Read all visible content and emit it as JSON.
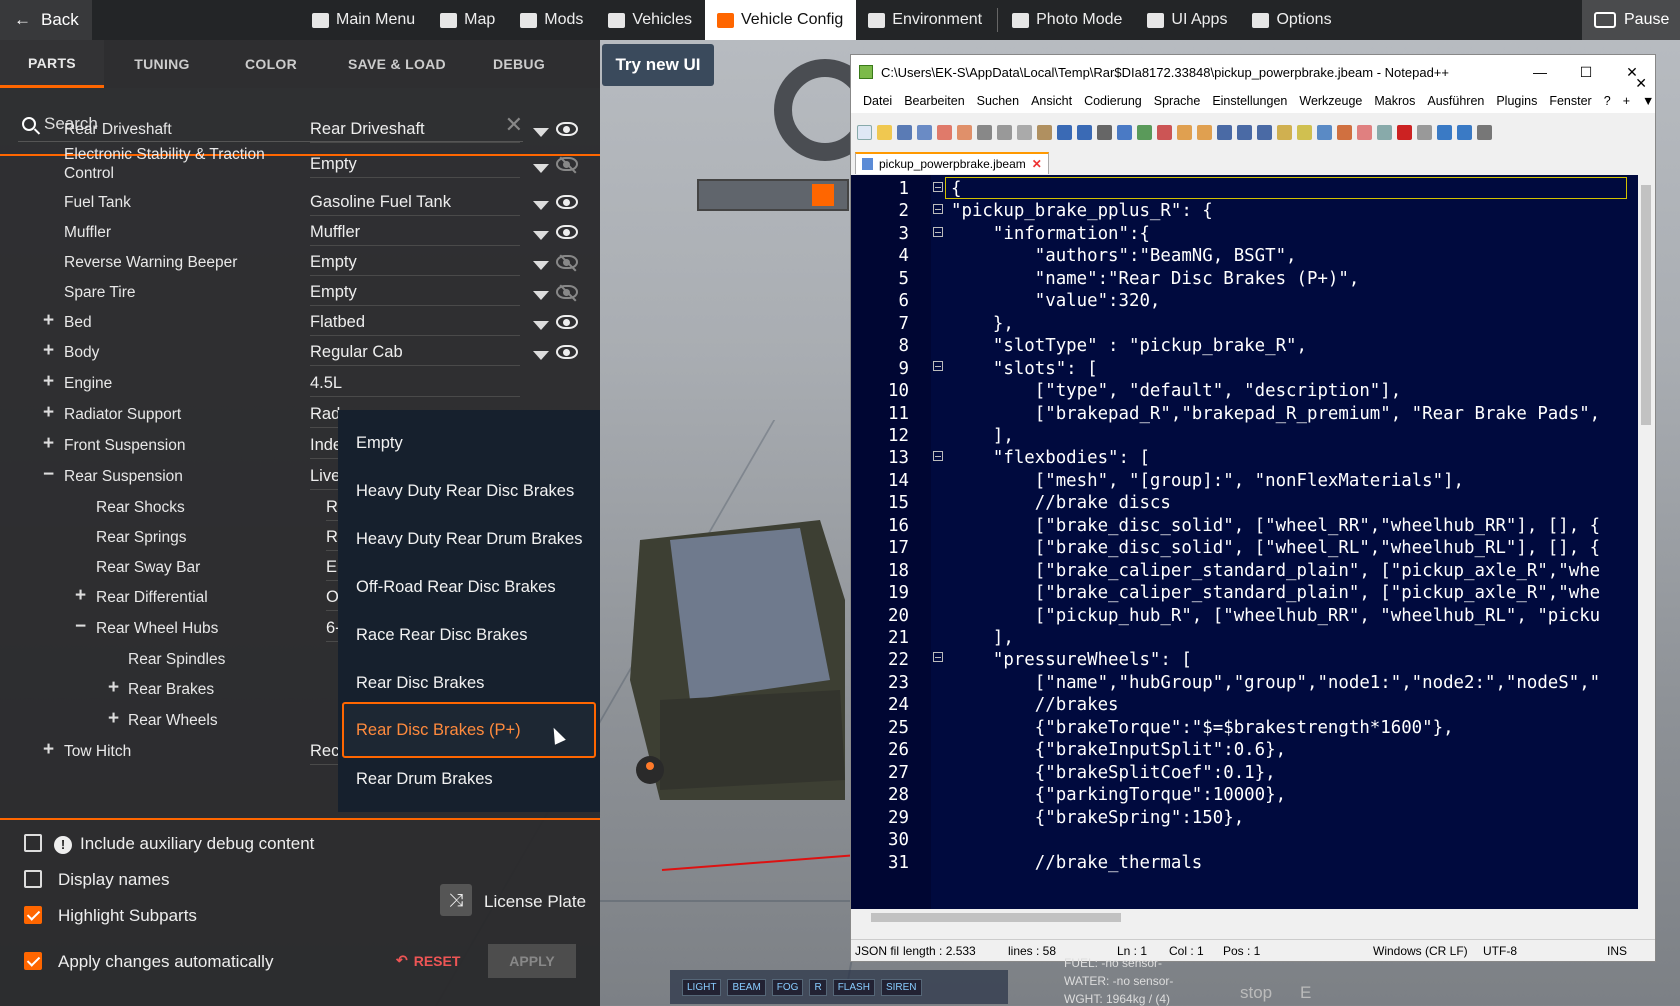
{
  "topbar": {
    "back": "Back",
    "nav": [
      {
        "label": "Main Menu",
        "icon": "main-menu-icon"
      },
      {
        "label": "Map",
        "icon": "map-icon"
      },
      {
        "label": "Mods",
        "icon": "mods-icon"
      },
      {
        "label": "Vehicles",
        "icon": "vehicles-icon"
      },
      {
        "label": "Vehicle Config",
        "icon": "vehicle-config-icon",
        "active": true
      },
      {
        "label": "Environment",
        "icon": "environment-icon"
      },
      {
        "label": "Photo Mode",
        "icon": "camera-icon"
      },
      {
        "label": "UI Apps",
        "icon": "ui-apps-icon"
      },
      {
        "label": "Options",
        "icon": "options-icon"
      }
    ],
    "pause": "Pause"
  },
  "tabs": [
    "PARTS",
    "TUNING",
    "COLOR",
    "SAVE & LOAD",
    "DEBUG"
  ],
  "search": {
    "placeholder": "Search"
  },
  "parts": [
    {
      "name": "Rear Driveshaft",
      "value": "Rear Driveshaft",
      "visible": true
    },
    {
      "name": "Electronic Stability & Traction",
      "name2": "Control",
      "value": "Empty",
      "visible": false
    },
    {
      "name": "Fuel Tank",
      "value": "Gasoline Fuel Tank",
      "visible": true
    },
    {
      "name": "Muffler",
      "value": "Muffler",
      "visible": true
    },
    {
      "name": "Reverse Warning Beeper",
      "value": "Empty",
      "visible": false
    },
    {
      "name": "Spare Tire",
      "value": "Empty",
      "visible": false
    },
    {
      "name": "Bed",
      "value": "Flatbed",
      "visible": true,
      "toggle": "+"
    },
    {
      "name": "Body",
      "value": "Regular Cab",
      "visible": true,
      "toggle": "+"
    },
    {
      "name": "Engine",
      "value": "4.5L",
      "toggle": "+"
    },
    {
      "name": "Radiator Support",
      "value": "Rad",
      "toggle": "+"
    },
    {
      "name": "Front Suspension",
      "value": "Inde",
      "toggle": "+"
    },
    {
      "name": "Rear Suspension",
      "value": "Live",
      "toggle": "−"
    },
    {
      "name": "Rear Shocks",
      "value": "R"
    },
    {
      "name": "Rear Springs",
      "value": "R"
    },
    {
      "name": "Rear Sway Bar",
      "value": "E"
    },
    {
      "name": "Rear Differential",
      "value": "O",
      "toggle": "+"
    },
    {
      "name": "Rear Wheel Hubs",
      "value": "6-",
      "toggle": "−"
    },
    {
      "name": "Rear Spindles",
      "value": ""
    },
    {
      "name": "Rear Brakes",
      "value": "",
      "toggle": "+"
    },
    {
      "name": "Rear Wheels",
      "value": "",
      "toggle": "+"
    },
    {
      "name": "Tow Hitch",
      "value": "Rec",
      "toggle": "+"
    }
  ],
  "dropdown": {
    "options": [
      "Empty",
      "Heavy Duty Rear Disc Brakes",
      "Heavy Duty Rear Drum Brakes",
      "Off-Road Rear Disc Brakes",
      "Race Rear Disc Brakes",
      "Rear Disc Brakes",
      "Rear Disc Brakes (P+)",
      "Rear Drum Brakes"
    ],
    "selected": "Rear Disc Brakes (P+)"
  },
  "options": {
    "aux_debug": {
      "label": "Include auxiliary debug content",
      "checked": false
    },
    "display_names": {
      "label": "Display names",
      "checked": false
    },
    "highlight_subparts": {
      "label": "Highlight Subparts",
      "checked": true
    },
    "apply_auto": {
      "label": "Apply changes automatically",
      "checked": true
    },
    "license_plate": "License Plate",
    "reset": "RESET",
    "apply": "APPLY"
  },
  "try_new_ui": "Try new UI",
  "notepad": {
    "title": "C:\\Users\\EK-S\\AppData\\Local\\Temp\\Rar$DIa8172.33848\\pickup_powerpbrake.jbeam - Notepad++",
    "menu": [
      "Datei",
      "Bearbeiten",
      "Suchen",
      "Ansicht",
      "Codierung",
      "Sprache",
      "Einstellungen",
      "Werkzeuge",
      "Makros",
      "Ausführen",
      "Plugins",
      "Fenster",
      "?",
      "+",
      "▼"
    ],
    "tab": "pickup_powerpbrake.jbeam",
    "lines": [
      "{",
      "\"pickup_brake_pplus_R\": {",
      "    \"information\":{",
      "        \"authors\":\"BeamNG, BSGT\",",
      "        \"name\":\"Rear Disc Brakes (P+)\",",
      "        \"value\":320,",
      "    },",
      "    \"slotType\" : \"pickup_brake_R\",",
      "    \"slots\": [",
      "        [\"type\", \"default\", \"description\"],",
      "        [\"brakepad_R\",\"brakepad_R_premium\", \"Rear Brake Pads\",",
      "    ],",
      "    \"flexbodies\": [",
      "        [\"mesh\", \"[group]:\", \"nonFlexMaterials\"],",
      "        //brake discs",
      "        [\"brake_disc_solid\", [\"wheel_RR\",\"wheelhub_RR\"], [], {",
      "        [\"brake_disc_solid\", [\"wheel_RL\",\"wheelhub_RL\"], [], {",
      "        [\"brake_caliper_standard_plain\", [\"pickup_axle_R\",\"whe",
      "        [\"brake_caliper_standard_plain\", [\"pickup_axle_R\",\"whe",
      "        [\"pickup_hub_R\", [\"wheelhub_RR\", \"wheelhub_RL\", \"picku",
      "    ],",
      "    \"pressureWheels\": [",
      "        [\"name\",\"hubGroup\",\"group\",\"node1:\",\"node2:\",\"nodeS\",\"",
      "        //brakes",
      "        {\"brakeTorque\":\"$=$brakestrength*1600\"},",
      "        {\"brakeInputSplit\":0.6},",
      "        {\"brakeSplitCoef\":0.1},",
      "        {\"parkingTorque\":10000},",
      "        {\"brakeSpring\":150},",
      "",
      "        //brake_thermals"
    ],
    "status": {
      "type": "JSON fil",
      "length": "length : 2.533",
      "lines": "lines : 58",
      "ln": "Ln : 1",
      "col": "Col : 1",
      "pos": "Pos : 1",
      "eol": "Windows (CR LF)",
      "enc": "UTF-8",
      "mode": "INS"
    }
  },
  "hud": {
    "fuel": "FUEL: -no sensor-",
    "water": "WATER: -no sensor-",
    "weight": "WGHT: 1964kg / (4)",
    "stop": "stop",
    "e": "E",
    "lights": [
      "LIGHT",
      "BEAM",
      "FOG",
      "R",
      "FLASH",
      "SIREN"
    ]
  }
}
